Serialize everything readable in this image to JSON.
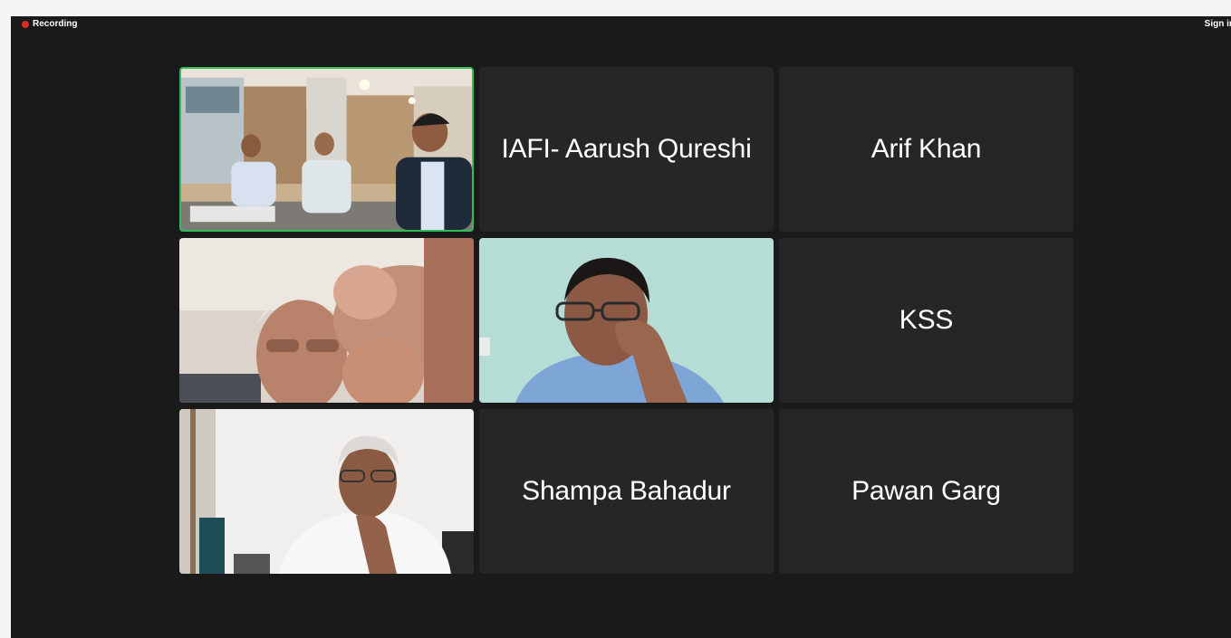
{
  "header": {
    "recording_label": "Recording",
    "signin_label": "Sign in"
  },
  "colors": {
    "window_bg": "#1a1a1a",
    "tile_bg": "#262626",
    "active_speaker_border": "#2fbd55",
    "recording_dot": "#e02828"
  },
  "participants": [
    {
      "type": "video",
      "name": "",
      "active_speaker": true
    },
    {
      "type": "name",
      "name": "IAFI- Aarush Qureshi"
    },
    {
      "type": "name",
      "name": "Arif Khan"
    },
    {
      "type": "video",
      "name": ""
    },
    {
      "type": "video",
      "name": ""
    },
    {
      "type": "name",
      "name": "KSS"
    },
    {
      "type": "video",
      "name": ""
    },
    {
      "type": "name",
      "name": "Shampa Bahadur"
    },
    {
      "type": "name",
      "name": "Pawan Garg"
    }
  ]
}
